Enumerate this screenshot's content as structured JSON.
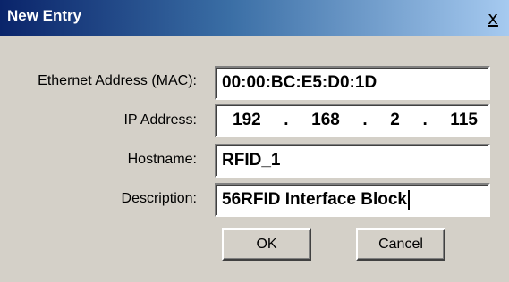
{
  "window": {
    "title": "New Entry",
    "close_glyph": "x"
  },
  "form": {
    "mac_label": "Ethernet Address (MAC):",
    "mac_value": "00:00:BC:E5:D0:1D",
    "ip_label": "IP Address:",
    "ip_octets": [
      "192",
      "168",
      "2",
      "115"
    ],
    "ip_separator": ".",
    "hostname_label": "Hostname:",
    "hostname_value": "RFID_1",
    "description_label": "Description:",
    "description_value": "56RFID Interface Block"
  },
  "buttons": {
    "ok_label": "OK",
    "cancel_label": "Cancel"
  },
  "colors": {
    "titlebar_start": "#0a246a",
    "titlebar_end": "#a6caf0",
    "dialog_bg": "#d4d0c8"
  }
}
